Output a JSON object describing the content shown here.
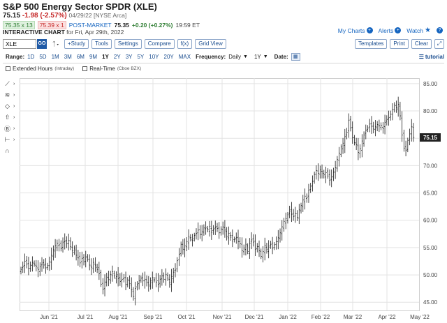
{
  "header": {
    "title": "S&P 500 Energy Sector SPDR (XLE)",
    "last": "75.15",
    "change": "-1.98 (-2.57%)",
    "date_exchange": "04/29/22 [NYSE Arca]",
    "bid": "75.35 x 13",
    "ask": "75.39 x 1",
    "post_label": "POST-MARKET",
    "post_price": "75.35",
    "post_change": "+0.20 (+0.27%)",
    "post_time": "19:59 ET",
    "chart_title": "INTERACTIVE CHART",
    "chart_for": "for Fri, Apr 29th, 2022"
  },
  "links": {
    "my_charts": "My Charts",
    "alerts": "Alerts",
    "watch": "Watch",
    "help": "?"
  },
  "toolbar": {
    "symbol": "XLE",
    "go": "GO",
    "buttons": [
      "+Study",
      "Tools",
      "Settings",
      "Compare",
      "f(x)",
      "Grid View"
    ],
    "templates": "Templates",
    "print": "Print",
    "clear": "Clear",
    "expand": "⤢"
  },
  "rangebar": {
    "label": "Range:",
    "ranges": [
      "1D",
      "5D",
      "1M",
      "3M",
      "6M",
      "9M",
      "1Y",
      "2Y",
      "3Y",
      "5Y",
      "10Y",
      "20Y",
      "MAX"
    ],
    "active": "1Y",
    "frequency_label": "Frequency:",
    "frequency": "Daily",
    "period": "1Y",
    "date_label": "Date:",
    "tutorial": "tutorial"
  },
  "checks": {
    "extended": "Extended Hours",
    "extended_note": "(Intraday)",
    "realtime": "Real-Time",
    "realtime_note": "(Cboe BZX)"
  },
  "tools": [
    "line-tool",
    "fib-tool",
    "shape-tool",
    "arrow-tool",
    "annotation-tool",
    "measure-tool",
    "magnet-tool"
  ],
  "chart_data": {
    "type": "ohlc",
    "xlabels": [
      "Jun '21",
      "Jul '21",
      "Aug '21",
      "Sep '21",
      "Oct '21",
      "Nov '21",
      "Dec '21",
      "Jan '22",
      "Feb '22",
      "Mar '22",
      "Apr '22",
      "May '22"
    ],
    "yticks": [
      "85.00",
      "80.00",
      "75.00",
      "70.00",
      "65.00",
      "60.00",
      "55.00",
      "50.00",
      "45.00"
    ],
    "ylim": [
      43.5,
      86
    ],
    "last_price_label": "75.15",
    "grid": true,
    "closes": [
      51,
      51.5,
      52.5,
      52,
      51.2,
      51.8,
      52.3,
      52,
      51.6,
      51,
      51.5,
      52,
      51.8,
      51.3,
      51.7,
      52.4,
      53.6,
      54.6,
      55.3,
      55.8,
      55.5,
      54.8,
      55.9,
      56.2,
      55.7,
      56.3,
      55.2,
      54.4,
      54.9,
      53.6,
      53.1,
      52.2,
      53,
      52.4,
      53.3,
      52.9,
      51.8,
      51.4,
      52.3,
      51.8,
      51,
      50.2,
      48.3,
      47.4,
      48.7,
      49.6,
      49.2,
      50.1,
      50.6,
      49.8,
      49.7,
      49.3,
      48.8,
      49.2,
      49.5,
      48.3,
      49.1,
      48.4,
      47.3,
      46.1,
      47.5,
      48.2,
      48.9,
      49.4,
      48.9,
      49.2,
      48.7,
      48.2,
      48.9,
      49.5,
      49.1,
      48.7,
      48.3,
      49.2,
      49.8,
      49.2,
      50.1,
      49.4,
      48.6,
      49.7,
      50.5,
      50.9,
      52.6,
      53.8,
      55.6,
      54.7,
      55.3,
      56.1,
      57.1,
      56.8,
      56.3,
      57.2,
      57.6,
      58.2,
      57.4,
      57.9,
      58.6,
      58.7,
      58.3,
      58.9,
      57.8,
      58.3,
      58.7,
      58.5,
      57.7,
      58.4,
      58.8,
      58.2,
      57.1,
      57.6,
      56.9,
      56.2,
      56.5,
      56.8,
      56.1,
      55.7,
      54.4,
      54.9,
      55.6,
      54.3,
      55.8,
      56.4,
      56,
      54.7,
      55.2,
      54.4,
      53.4,
      54.3,
      55.4,
      54.7,
      55.1,
      55.6,
      54.9,
      55.5,
      56.1,
      56.8,
      57.7,
      58.8,
      59.8,
      60.3,
      61,
      61.7,
      61.1,
      60.7,
      61.2,
      60.5,
      61.9,
      62.7,
      63.7,
      64.4,
      64.1,
      65.4,
      66.2,
      67.1,
      68.4,
      69.1,
      68.6,
      69.2,
      68.9,
      68.3,
      68.7,
      68.1,
      67.3,
      67.9,
      68.8,
      69.6,
      71.1,
      72.3,
      73.4,
      74.1,
      75.3,
      76.1,
      78.3,
      76.9,
      75.1,
      74.2,
      73.8,
      72.4,
      73.1,
      74.5,
      75.6,
      76.4,
      76.9,
      77.6,
      77.2,
      76.7,
      77.1,
      77.5,
      77.3,
      77.4,
      76.8,
      77.9,
      78.4,
      78.8,
      79.4,
      80.3,
      81.1,
      80.6,
      81.2,
      79.1,
      75.6,
      73.2,
      72.8,
      74.6,
      75.8,
      77.1,
      75.15
    ]
  }
}
